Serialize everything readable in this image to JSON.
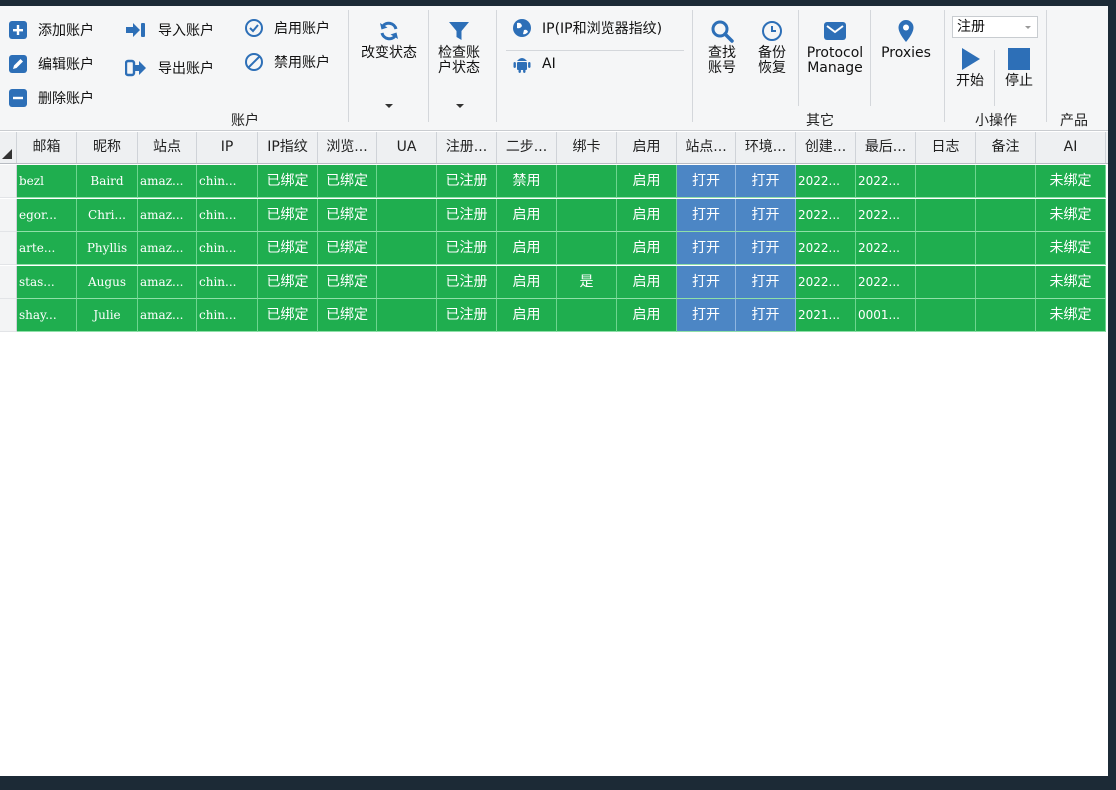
{
  "ribbon": {
    "account": {
      "add": "添加账户",
      "edit": "编辑账户",
      "delete": "删除账户",
      "import": "导入账户",
      "export": "导出账户",
      "enable": "启用账户",
      "disable": "禁用账户",
      "group_label": "账户"
    },
    "change_status": "改变状态",
    "check_status_line1": "检查账",
    "check_status_line2": "户状态",
    "ip_fingerprint": "IP(IP和浏览器指纹)",
    "ai": "AI",
    "find_line1": "查找",
    "find_line2": "账号",
    "backup_line1": "备份",
    "backup_line2": "恢复",
    "protocol_line1": "Protocol",
    "protocol_line2": "Manage",
    "proxies": "Proxies",
    "other_group_label": "其它",
    "mode_select_value": "注册",
    "start": "开始",
    "stop": "停止",
    "small_ops_label": "小操作",
    "product_label": "产品"
  },
  "colors": {
    "row_green": "#1fae4f",
    "open_blue": "#4c86c5",
    "ribbon_blue": "#2d6fb7"
  },
  "table": {
    "columns": [
      "邮箱",
      "昵称",
      "站点",
      "IP",
      "IP指纹",
      "浏览...",
      "UA",
      "注册...",
      "二步...",
      "绑卡",
      "启用",
      "站点...",
      "环境...",
      "创建...",
      "最后...",
      "日志",
      "备注",
      "AI"
    ],
    "rows": [
      [
        "bezl",
        "Baird",
        "amaz...",
        "chin...",
        "已绑定",
        "已绑定",
        "",
        "已注册",
        "禁用",
        "",
        "启用",
        "打开",
        "打开",
        "2022...",
        "2022...",
        "",
        "",
        "未绑定"
      ],
      [
        "egor...",
        "Chri...",
        "amaz...",
        "chin...",
        "已绑定",
        "已绑定",
        "",
        "已注册",
        "启用",
        "",
        "启用",
        "打开",
        "打开",
        "2022...",
        "2022...",
        "",
        "",
        "未绑定"
      ],
      [
        "arte...",
        "Phyllis",
        "amaz...",
        "chin...",
        "已绑定",
        "已绑定",
        "",
        "已注册",
        "启用",
        "",
        "启用",
        "打开",
        "打开",
        "2022...",
        "2022...",
        "",
        "",
        "未绑定"
      ],
      [
        "stas...",
        "Augus",
        "amaz...",
        "chin...",
        "已绑定",
        "已绑定",
        "",
        "已注册",
        "启用",
        "是",
        "启用",
        "打开",
        "打开",
        "2022...",
        "2022...",
        "",
        "",
        "未绑定"
      ],
      [
        "shay...",
        "Julie",
        "amaz...",
        "chin...",
        "已绑定",
        "已绑定",
        "",
        "已注册",
        "启用",
        "",
        "启用",
        "打开",
        "打开",
        "2021...",
        "0001...",
        "",
        "",
        "未绑定"
      ]
    ]
  }
}
